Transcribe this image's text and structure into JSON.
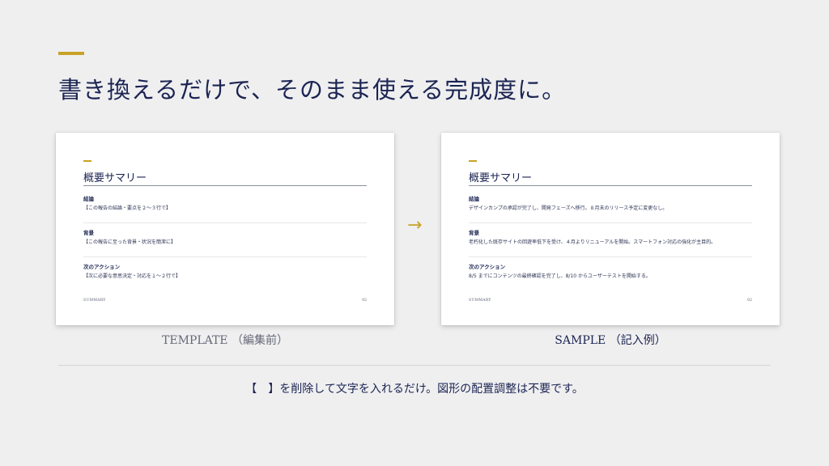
{
  "headline": "書き換えるだけで、そのまま使える完成度に。",
  "template_card": {
    "title": "概要サマリー",
    "sections": [
      {
        "heading": "結論",
        "body": "【この報告の結論・要点を２〜３行で】"
      },
      {
        "heading": "背景",
        "body": "【この報告に至った背景・状況を簡潔に】"
      },
      {
        "heading": "次のアクション",
        "body": "【次に必要な意思決定・対応を１〜２行で】"
      }
    ],
    "footer_label": "SUMMARY",
    "page_number": "02"
  },
  "sample_card": {
    "title": "概要サマリー",
    "sections": [
      {
        "heading": "結論",
        "body": "デザインカンプの承認が完了し、開発フェーズへ移行。８月末のリリース予定に変更なし。"
      },
      {
        "heading": "背景",
        "body": "老朽化した既存サイトの回遊率低下を受け、４月よりリニューアルを開始。スマートフォン対応の強化が主目的。"
      },
      {
        "heading": "次のアクション",
        "body": "8/5 までにコンテンツの最終確認を完了し、8/10 からユーザーテストを開始する。"
      }
    ],
    "footer_label": "SUMMARY",
    "page_number": "02"
  },
  "arrow": "→",
  "captions": {
    "template": "TEMPLATE （編集前）",
    "sample": "SAMPLE （記入例）"
  },
  "note": "【　】を削除して文字を入れるだけ。図形の配置調整は不要です。",
  "colors": {
    "accent": "#c9a227",
    "navy": "#1b2452",
    "background": "#efeff0"
  }
}
